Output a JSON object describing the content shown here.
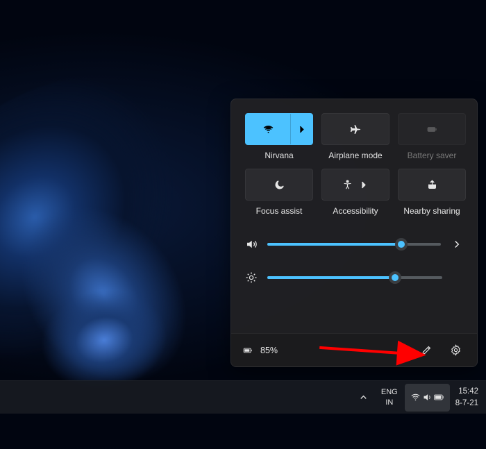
{
  "panel": {
    "tiles": [
      {
        "name": "wifi",
        "label": "Nirvana",
        "active": true,
        "split": true,
        "icon": "wifi-icon"
      },
      {
        "name": "airplane",
        "label": "Airplane mode",
        "active": false,
        "icon": "airplane-icon"
      },
      {
        "name": "battery-saver",
        "label": "Battery saver",
        "disabled": true,
        "icon": "battery-saver-icon"
      },
      {
        "name": "focus-assist",
        "label": "Focus assist",
        "active": false,
        "icon": "moon-icon"
      },
      {
        "name": "accessibility",
        "label": "Accessibility",
        "active": false,
        "hasSub": true,
        "icon": "accessibility-icon"
      },
      {
        "name": "nearby-sharing",
        "label": "Nearby sharing",
        "active": false,
        "icon": "share-icon"
      }
    ],
    "volume": 77,
    "brightness": 73,
    "battery": "85%"
  },
  "taskbar": {
    "lang_top": "ENG",
    "lang_bottom": "IN",
    "time": "15:42",
    "date": "8-7-21"
  },
  "colors": {
    "accent": "#4cc2ff"
  }
}
